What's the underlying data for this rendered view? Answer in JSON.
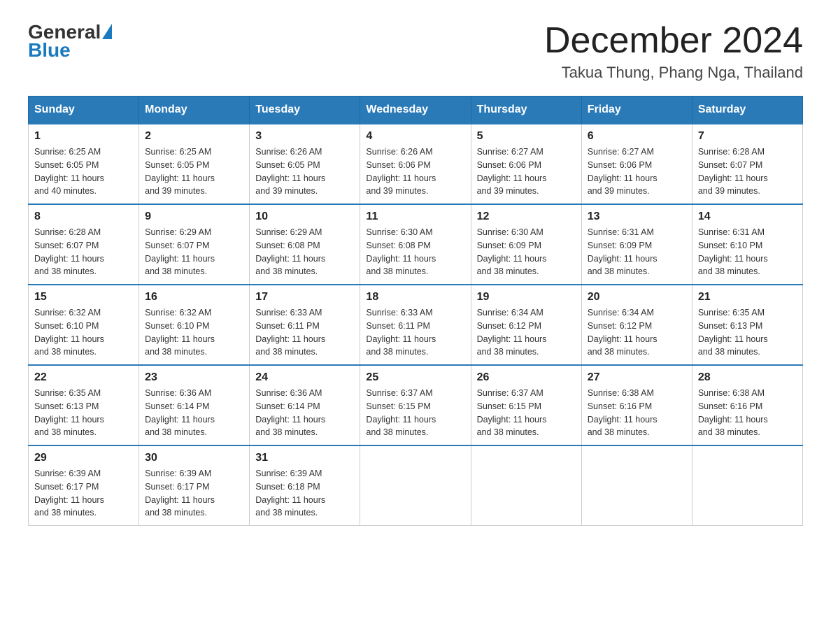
{
  "logo": {
    "general": "General",
    "blue": "Blue"
  },
  "title": {
    "month": "December 2024",
    "location": "Takua Thung, Phang Nga, Thailand"
  },
  "headers": [
    "Sunday",
    "Monday",
    "Tuesday",
    "Wednesday",
    "Thursday",
    "Friday",
    "Saturday"
  ],
  "weeks": [
    [
      {
        "day": "1",
        "sunrise": "6:25 AM",
        "sunset": "6:05 PM",
        "daylight": "11 hours and 40 minutes."
      },
      {
        "day": "2",
        "sunrise": "6:25 AM",
        "sunset": "6:05 PM",
        "daylight": "11 hours and 39 minutes."
      },
      {
        "day": "3",
        "sunrise": "6:26 AM",
        "sunset": "6:05 PM",
        "daylight": "11 hours and 39 minutes."
      },
      {
        "day": "4",
        "sunrise": "6:26 AM",
        "sunset": "6:06 PM",
        "daylight": "11 hours and 39 minutes."
      },
      {
        "day": "5",
        "sunrise": "6:27 AM",
        "sunset": "6:06 PM",
        "daylight": "11 hours and 39 minutes."
      },
      {
        "day": "6",
        "sunrise": "6:27 AM",
        "sunset": "6:06 PM",
        "daylight": "11 hours and 39 minutes."
      },
      {
        "day": "7",
        "sunrise": "6:28 AM",
        "sunset": "6:07 PM",
        "daylight": "11 hours and 39 minutes."
      }
    ],
    [
      {
        "day": "8",
        "sunrise": "6:28 AM",
        "sunset": "6:07 PM",
        "daylight": "11 hours and 38 minutes."
      },
      {
        "day": "9",
        "sunrise": "6:29 AM",
        "sunset": "6:07 PM",
        "daylight": "11 hours and 38 minutes."
      },
      {
        "day": "10",
        "sunrise": "6:29 AM",
        "sunset": "6:08 PM",
        "daylight": "11 hours and 38 minutes."
      },
      {
        "day": "11",
        "sunrise": "6:30 AM",
        "sunset": "6:08 PM",
        "daylight": "11 hours and 38 minutes."
      },
      {
        "day": "12",
        "sunrise": "6:30 AM",
        "sunset": "6:09 PM",
        "daylight": "11 hours and 38 minutes."
      },
      {
        "day": "13",
        "sunrise": "6:31 AM",
        "sunset": "6:09 PM",
        "daylight": "11 hours and 38 minutes."
      },
      {
        "day": "14",
        "sunrise": "6:31 AM",
        "sunset": "6:10 PM",
        "daylight": "11 hours and 38 minutes."
      }
    ],
    [
      {
        "day": "15",
        "sunrise": "6:32 AM",
        "sunset": "6:10 PM",
        "daylight": "11 hours and 38 minutes."
      },
      {
        "day": "16",
        "sunrise": "6:32 AM",
        "sunset": "6:10 PM",
        "daylight": "11 hours and 38 minutes."
      },
      {
        "day": "17",
        "sunrise": "6:33 AM",
        "sunset": "6:11 PM",
        "daylight": "11 hours and 38 minutes."
      },
      {
        "day": "18",
        "sunrise": "6:33 AM",
        "sunset": "6:11 PM",
        "daylight": "11 hours and 38 minutes."
      },
      {
        "day": "19",
        "sunrise": "6:34 AM",
        "sunset": "6:12 PM",
        "daylight": "11 hours and 38 minutes."
      },
      {
        "day": "20",
        "sunrise": "6:34 AM",
        "sunset": "6:12 PM",
        "daylight": "11 hours and 38 minutes."
      },
      {
        "day": "21",
        "sunrise": "6:35 AM",
        "sunset": "6:13 PM",
        "daylight": "11 hours and 38 minutes."
      }
    ],
    [
      {
        "day": "22",
        "sunrise": "6:35 AM",
        "sunset": "6:13 PM",
        "daylight": "11 hours and 38 minutes."
      },
      {
        "day": "23",
        "sunrise": "6:36 AM",
        "sunset": "6:14 PM",
        "daylight": "11 hours and 38 minutes."
      },
      {
        "day": "24",
        "sunrise": "6:36 AM",
        "sunset": "6:14 PM",
        "daylight": "11 hours and 38 minutes."
      },
      {
        "day": "25",
        "sunrise": "6:37 AM",
        "sunset": "6:15 PM",
        "daylight": "11 hours and 38 minutes."
      },
      {
        "day": "26",
        "sunrise": "6:37 AM",
        "sunset": "6:15 PM",
        "daylight": "11 hours and 38 minutes."
      },
      {
        "day": "27",
        "sunrise": "6:38 AM",
        "sunset": "6:16 PM",
        "daylight": "11 hours and 38 minutes."
      },
      {
        "day": "28",
        "sunrise": "6:38 AM",
        "sunset": "6:16 PM",
        "daylight": "11 hours and 38 minutes."
      }
    ],
    [
      {
        "day": "29",
        "sunrise": "6:39 AM",
        "sunset": "6:17 PM",
        "daylight": "11 hours and 38 minutes."
      },
      {
        "day": "30",
        "sunrise": "6:39 AM",
        "sunset": "6:17 PM",
        "daylight": "11 hours and 38 minutes."
      },
      {
        "day": "31",
        "sunrise": "6:39 AM",
        "sunset": "6:18 PM",
        "daylight": "11 hours and 38 minutes."
      },
      null,
      null,
      null,
      null
    ]
  ],
  "labels": {
    "sunrise": "Sunrise:",
    "sunset": "Sunset:",
    "daylight": "Daylight:"
  }
}
